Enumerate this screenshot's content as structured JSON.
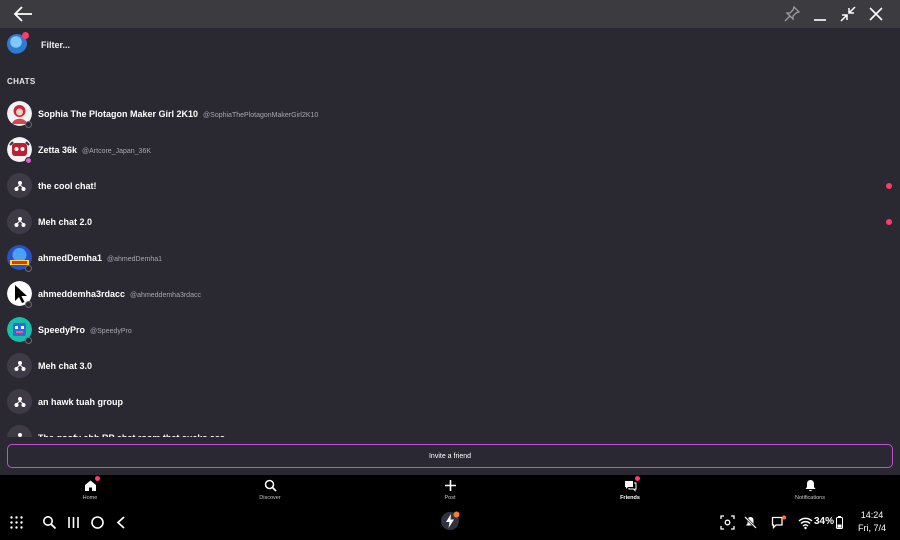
{
  "icons": {
    "back": "back-arrow-icon",
    "pin": "pin-icon",
    "minimize": "minimize-icon",
    "restore": "restore-icon",
    "close": "close-icon"
  },
  "filter": {
    "label": "Filter..."
  },
  "section": {
    "title": "CHATS"
  },
  "chats": [
    {
      "name": "Sophia The Plotagon Maker Girl 2K10",
      "handle": "@SophiaThePlotagonMakerGirl2K10",
      "kind": "user",
      "unread": false
    },
    {
      "name": "Zetta 36k",
      "handle": "@Artcore_Japan_36K",
      "kind": "user",
      "unread": false
    },
    {
      "name": "the cool chat!",
      "handle": "",
      "kind": "group",
      "unread": true
    },
    {
      "name": "Meh chat 2.0",
      "handle": "",
      "kind": "group",
      "unread": true
    },
    {
      "name": "ahmedDemha1",
      "handle": "@ahmedDemha1",
      "kind": "user",
      "unread": false
    },
    {
      "name": "ahmeddemha3rdacc",
      "handle": "@ahmeddemha3rdacc",
      "kind": "user",
      "unread": false
    },
    {
      "name": "SpeedyPro",
      "handle": "@SpeedyPro",
      "kind": "user",
      "unread": false
    },
    {
      "name": "Meh chat 3.0",
      "handle": "",
      "kind": "group",
      "unread": false
    },
    {
      "name": "an hawk tuah group",
      "handle": "",
      "kind": "group",
      "unread": false
    },
    {
      "name": "The goofy ahh RP chat room that sucks ass",
      "handle": "",
      "kind": "group",
      "unread": false
    }
  ],
  "invite": {
    "label": "Invite a friend"
  },
  "tabs": [
    {
      "label": "Home",
      "icon": "home-icon",
      "badge": true,
      "active": false
    },
    {
      "label": "Discover",
      "icon": "search-icon",
      "badge": false,
      "active": false
    },
    {
      "label": "Post",
      "icon": "plus-icon",
      "badge": false,
      "active": false
    },
    {
      "label": "Friends",
      "icon": "chat-bubbles-icon",
      "badge": true,
      "active": true
    },
    {
      "label": "Notifications",
      "icon": "bell-icon",
      "badge": false,
      "active": false
    }
  ],
  "status": {
    "battery": "34%",
    "time": "14:24",
    "date": "Fri, 7/4"
  },
  "colors": {
    "accent": "#c24fd8",
    "unread": "#ff3b6b",
    "background": "#2a2830"
  }
}
